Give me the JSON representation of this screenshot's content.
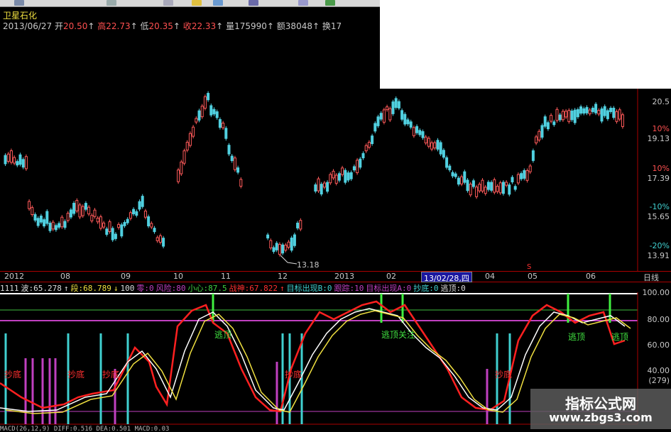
{
  "toolbar": {
    "icons": [
      "home-icon",
      "arrow-icon",
      "window-icon",
      "folder-icon",
      "search-icon",
      "chart-icon",
      "pie-icon",
      "grid-icon"
    ]
  },
  "header": {
    "stock_name": "卫星石化",
    "date": "2013/06/27",
    "open_label": "开",
    "open": "20.50",
    "high_label": "高",
    "high": "22.73",
    "low_label": "低",
    "low": "20.35",
    "close_label": "收",
    "close": "22.33",
    "volume_label": "量",
    "volume": "175990",
    "amount_label": "额",
    "amount": "38048",
    "turnover_label": "换",
    "turnover": "17"
  },
  "price_axis": {
    "labels": [
      "20.5",
      "10%",
      "19.13",
      "10%",
      "17.39",
      "-10%",
      "15.65",
      "-20%",
      "13.91"
    ],
    "low_marker": "13.18"
  },
  "dates": [
    "2012",
    "08",
    "09",
    "10",
    "11",
    "12",
    "2013",
    "02",
    "04",
    "05",
    "06"
  ],
  "date_cursor": "13/02/28,四",
  "period_label": "日线",
  "indicator_header": [
    {
      "text": "1111",
      "color": "#dddddd"
    },
    {
      "text": "波:65.278",
      "color": "#dddddd"
    },
    {
      "text": "↑",
      "color": "#dddddd"
    },
    {
      "text": "段:68.789",
      "color": "#f0e040"
    },
    {
      "text": "↓",
      "color": "#f0e040"
    },
    {
      "text": "100",
      "color": "#dddddd"
    },
    {
      "text": "零:0",
      "color": "#c040c0"
    },
    {
      "text": "风险:80",
      "color": "#c040c0"
    },
    {
      "text": "小心:87.5",
      "color": "#40d040"
    },
    {
      "text": "战神:67.822",
      "color": "#ff3030"
    },
    {
      "text": "↑",
      "color": "#ff3030"
    },
    {
      "text": "目标出现B:0",
      "color": "#40d0d0"
    },
    {
      "text": "跟踪:10",
      "color": "#c040c0"
    },
    {
      "text": "目标出现A:0",
      "color": "#c040c0"
    },
    {
      "text": "抄底:0",
      "color": "#40d0d0"
    },
    {
      "text": "逃顶:0",
      "color": "#dddddd"
    }
  ],
  "indicator_axis": [
    "100.00",
    "80.00",
    "60.00",
    "40.00"
  ],
  "indicator_count": "(279)",
  "signals": {
    "bottom_label": "抄底",
    "top_label": "逃顶",
    "top_watch_label": "逃顶关注"
  },
  "watermark": {
    "title": "指标公式网",
    "url": "www.zbgs3.com"
  },
  "footer_text": "MACD(26,12,9)  DIFF:0.516  DEA:0.501  MACD:0.03"
}
